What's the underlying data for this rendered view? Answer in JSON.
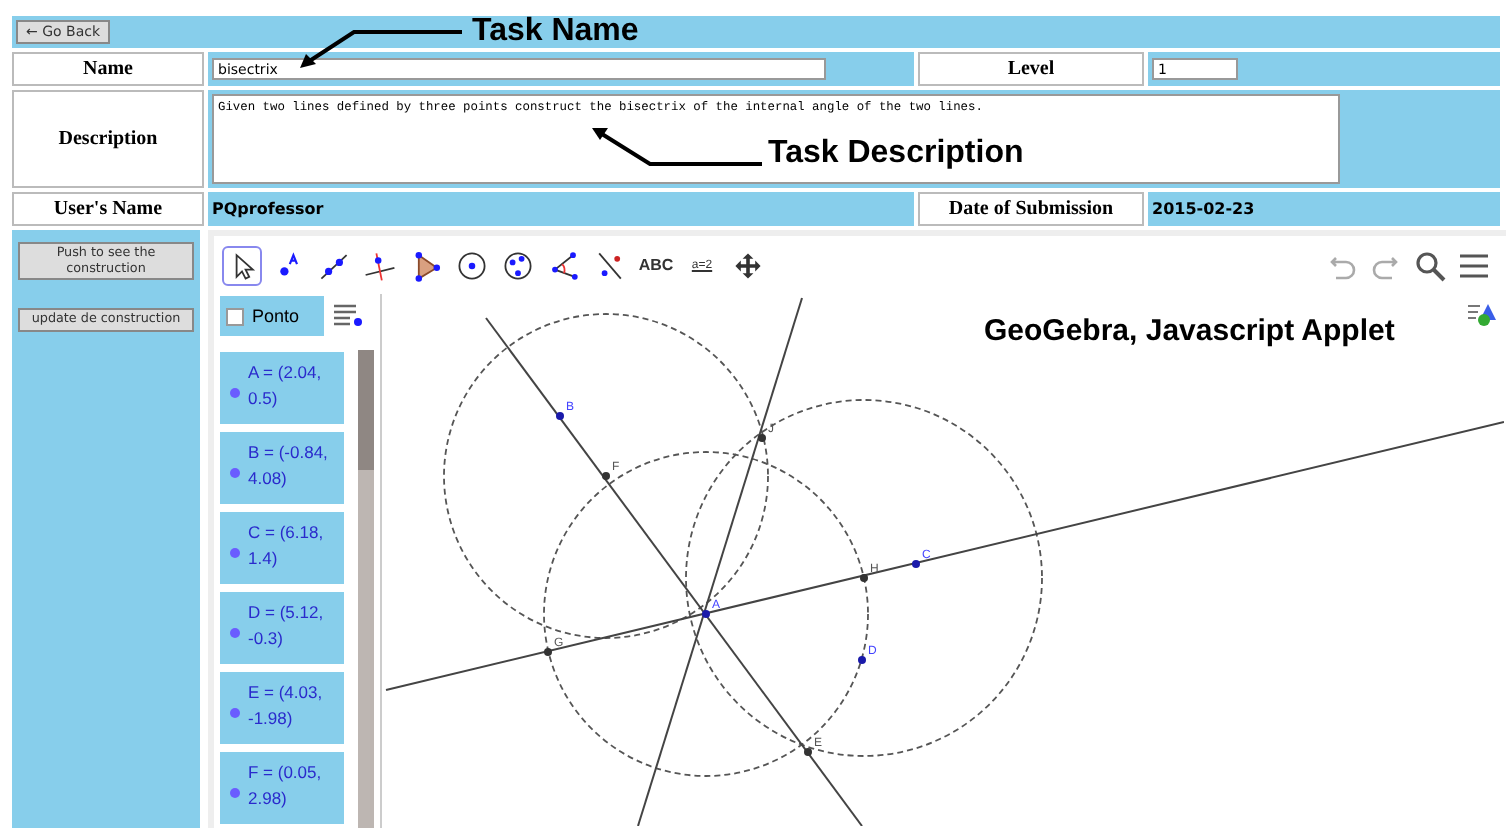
{
  "top_bar": {
    "back_button": "← Go Back"
  },
  "form": {
    "name_label": "Name",
    "name_value": "bisectrix",
    "level_label": "Level",
    "level_value": "1",
    "description_label": "Description",
    "description_value": "Given two lines defined by three points construct the bisectrix of the internal angle of the two lines.",
    "user_label": "User's Name",
    "user_value": "PQprofessor",
    "date_label": "Date of Submission",
    "date_value": "2015-02-23"
  },
  "side_buttons": [
    "Push to see the construction",
    "update de construction"
  ],
  "applet": {
    "tools": [
      {
        "kind": "pointer",
        "selected": true
      },
      {
        "kind": "point",
        "selected": false
      },
      {
        "kind": "line",
        "selected": false
      },
      {
        "kind": "perpendicular",
        "selected": false
      },
      {
        "kind": "polygon",
        "selected": false
      },
      {
        "kind": "circle",
        "selected": false
      },
      {
        "kind": "conic",
        "selected": false
      },
      {
        "kind": "angle",
        "selected": false
      },
      {
        "kind": "reflect",
        "selected": false
      },
      {
        "kind": "text",
        "label": "ABC",
        "selected": false
      },
      {
        "kind": "slider",
        "label": "a=2",
        "selected": false
      },
      {
        "kind": "move",
        "selected": false
      }
    ],
    "algebra": {
      "header": "Ponto",
      "items": [
        "A = (2.04, 0.5)",
        "B = (-0.84, 4.08)",
        "C = (6.18, 1.4)",
        "D = (5.12, -0.3)",
        "E = (4.03, -1.98)",
        "F = (0.05, 2.98)"
      ]
    },
    "graphics": {
      "points": [
        {
          "label": "B",
          "kind": "free"
        },
        {
          "label": "F",
          "kind": "constructed"
        },
        {
          "label": "J",
          "kind": "constructed"
        },
        {
          "label": "A",
          "kind": "free"
        },
        {
          "label": "G",
          "kind": "constructed"
        },
        {
          "label": "H",
          "kind": "constructed"
        },
        {
          "label": "C",
          "kind": "free"
        },
        {
          "label": "D",
          "kind": "free"
        },
        {
          "label": "E",
          "kind": "constructed"
        }
      ]
    }
  },
  "annotations": [
    {
      "kind": "name",
      "text": "Task Name"
    },
    {
      "kind": "description",
      "text": "Task Description"
    },
    {
      "kind": "applet",
      "text": "GeoGebra, Javascript Applet"
    }
  ]
}
